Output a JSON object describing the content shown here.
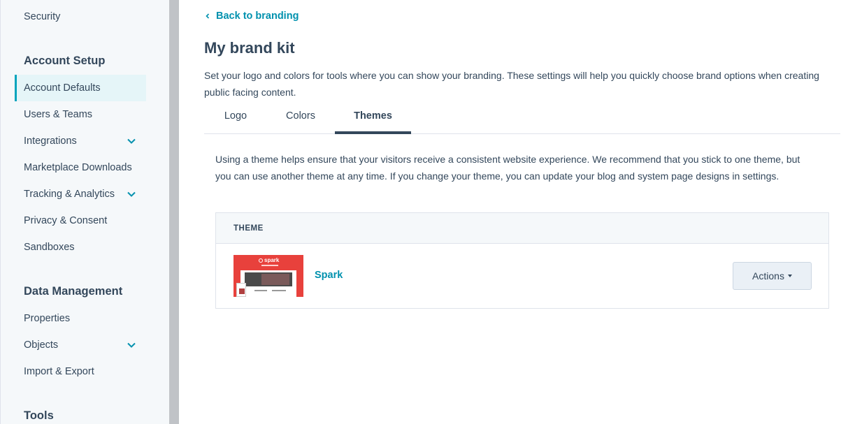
{
  "sidebar": {
    "top_item": "Security",
    "sections": [
      {
        "heading": "Account Setup",
        "items": [
          {
            "label": "Account Defaults",
            "active": true
          },
          {
            "label": "Users & Teams"
          },
          {
            "label": "Integrations",
            "expandable": true
          },
          {
            "label": "Marketplace Downloads"
          },
          {
            "label": "Tracking & Analytics",
            "expandable": true
          },
          {
            "label": "Privacy & Consent"
          },
          {
            "label": "Sandboxes"
          }
        ]
      },
      {
        "heading": "Data Management",
        "items": [
          {
            "label": "Properties"
          },
          {
            "label": "Objects",
            "expandable": true
          },
          {
            "label": "Import & Export"
          }
        ]
      },
      {
        "heading": "Tools",
        "items": []
      }
    ]
  },
  "header": {
    "back_link": "Back to branding",
    "title": "My brand kit",
    "description": "Set your logo and colors for tools where you can show your branding. These settings will help you quickly choose brand options when creating public facing content."
  },
  "tabs": [
    {
      "label": "Logo",
      "active": false
    },
    {
      "label": "Colors",
      "active": false
    },
    {
      "label": "Themes",
      "active": true
    }
  ],
  "themes_panel": {
    "info": "Using a theme helps ensure that your visitors receive a consistent website experience. We recommend that you stick to one theme, but you can use another theme at any time. If you change your theme, you can update your blog and system page designs in settings.",
    "table": {
      "column_header": "THEME",
      "rows": [
        {
          "thumbnail_brand": "spark",
          "name": "Spark",
          "actions_label": "Actions"
        }
      ]
    }
  },
  "colors": {
    "accent": "#00a4bd",
    "link": "#0091ae",
    "text": "#33475b",
    "thumbnail_red": "#e8413c"
  },
  "icons": {
    "back": "chevron-left-icon",
    "expand": "chevron-down-icon",
    "dropdown": "caret-down-icon"
  }
}
